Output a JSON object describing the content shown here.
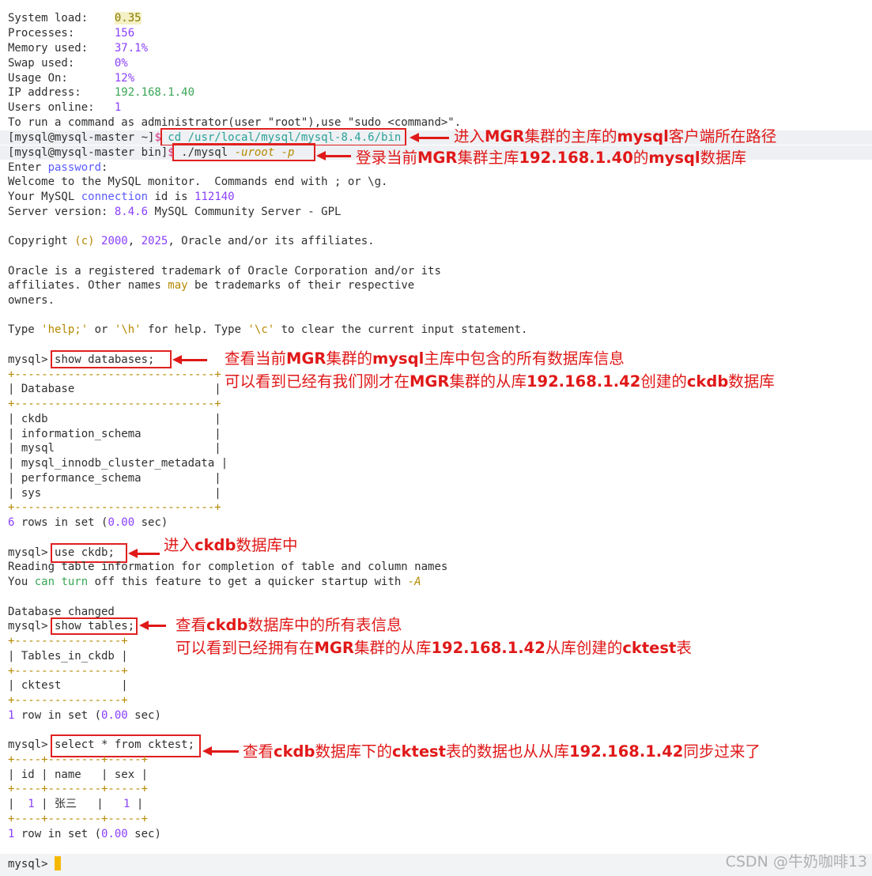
{
  "sysinfo": {
    "load_label": "System load:    ",
    "load_val": "0.35",
    "proc_label": "Processes:      ",
    "proc_val": "156",
    "mem_label": "Memory used:    ",
    "mem_val": "37.1%",
    "swap_label": "Swap used:      ",
    "swap_val": "0%",
    "usage_label": "Usage On:       ",
    "usage_val": "12%",
    "ip_label": "IP address:     ",
    "ip_val": "192.168.1.40",
    "users_label": "Users online:   ",
    "users_val": "1",
    "admin_msg": "To run a command as administrator(user \"root\"),use \"sudo <command>\"."
  },
  "prompt1": {
    "host": "[mysql@mysql-master ~]",
    "dollar": "$",
    "cmd": " cd /usr/local/mysql/mysql-8.4.6/bin"
  },
  "prompt2": {
    "host": "[mysql@mysql-master bin]",
    "dollar": "$",
    "cmd_a": " ./mysql ",
    "cmd_b": "-uroot -p"
  },
  "login": {
    "enter_a": "Enter ",
    "enter_b": "password",
    "enter_c": ":",
    "welcome": "Welcome to the MySQL monitor.  Commands end with ; or \\g.",
    "conn_a": "Your MySQL ",
    "conn_b": "connection",
    "conn_c": " id is ",
    "conn_d": "112140",
    "ver_a": "Server version: ",
    "ver_b": "8.4.6",
    "ver_c": " MySQL Community Server - GPL",
    "copy_a": "Copyright ",
    "copy_b": "(c) ",
    "copy_c": "2000",
    "copy_d": ", ",
    "copy_e": "2025",
    "copy_f": ", Oracle and/or its affiliates.",
    "tm1": "Oracle is a registered trademark of Oracle Corporation and/or its",
    "tm2_a": "affiliates. Other names ",
    "tm2_b": "may",
    "tm2_c": " be trademarks of their respective",
    "tm3": "owners.",
    "help_a": "Type ",
    "help_b": "'help;'",
    "help_c": " or ",
    "help_d": "'\\h'",
    "help_e": " for help. Type ",
    "help_f": "'\\c'",
    "help_g": " to clear the current input statement."
  },
  "q1": {
    "prompt": "mysql> ",
    "cmd": "show databases;",
    "border": "+------------------------------+",
    "header": "| Database                     |",
    "rows": [
      "| ckdb                         |",
      "| information_schema           |",
      "| mysql                        |",
      "| mysql_innodb_cluster_metadata |",
      "| performance_schema           |",
      "| sys                          |"
    ],
    "result_a": "6",
    "result_b": " rows in set (",
    "result_c": "0.00",
    "result_d": " sec)"
  },
  "q2": {
    "prompt": "mysql> ",
    "cmd": "use ckdb;",
    "read": "Reading table information for completion of table and column names",
    "turn_a": "You ",
    "turn_b": "can",
    "turn_c": " ",
    "turn_d": "turn",
    "turn_e": " off this feature to get a quicker startup with ",
    "turn_f": "-A",
    "changed": "Database changed"
  },
  "q3": {
    "prompt": "mysql> ",
    "cmd": "show tables;",
    "border": "+----------------+",
    "header": "| Tables_in_ckdb |",
    "row": "| cktest         |",
    "result_a": "1",
    "result_b": " row in set (",
    "result_c": "0.00",
    "result_d": " sec)"
  },
  "q4": {
    "prompt": "mysql> ",
    "cmd": "select * from cktest;",
    "border": "+----+--------+-----+",
    "header": "| id | name   | sex |",
    "row_a": "|  ",
    "row_id": "1",
    "row_b": " | 张三   |   ",
    "row_sex": "1",
    "row_c": " |",
    "result_a": "1",
    "result_b": " row in set (",
    "result_c": "0.00",
    "result_d": " sec)"
  },
  "final_prompt": "mysql> ",
  "notes": {
    "n1_a": "进入",
    "n1_b": "MGR",
    "n1_c": "集群的主库的",
    "n1_d": "mysql",
    "n1_e": "客户端所在路径",
    "n2_a": "登录当前",
    "n2_b": "MGR",
    "n2_c": "集群主库",
    "n2_d": "192.168.1.40",
    "n2_e": "的",
    "n2_f": "mysql",
    "n2_g": "数据库",
    "n3_a": "查看当前",
    "n3_b": "MGR",
    "n3_c": "集群的",
    "n3_d": "mysql",
    "n3_e": "主库中包含的所有数据库信息",
    "n4_a": "可以看到已经有我们刚才在",
    "n4_b": "MGR",
    "n4_c": "集群的从库",
    "n4_d": "192.168.1.42",
    "n4_e": "创建的",
    "n4_f": "ckdb",
    "n4_g": "数据库",
    "n5_a": "进入",
    "n5_b": "ckdb",
    "n5_c": "数据库中",
    "n6_a": "查看",
    "n6_b": "ckdb",
    "n6_c": "数据库中的所有表信息",
    "n7_a": "可以看到已经拥有在",
    "n7_b": "MGR",
    "n7_c": "集群的从库",
    "n7_d": "192.168.1.42",
    "n7_e": "从库创建的",
    "n7_f": "cktest",
    "n7_g": "表",
    "n8_a": "查看",
    "n8_b": "ckdb",
    "n8_c": "数据库下的",
    "n8_d": "cktest",
    "n8_e": "表的数据也从从库",
    "n8_f": "192.168.1.42",
    "n8_g": "同步过来了"
  },
  "watermark": "CSDN @牛奶咖啡13",
  "colors": {
    "annotation": "#e01818",
    "number": "#8a3ffc",
    "path": "#2aa198",
    "cursor": "#f5b800"
  }
}
